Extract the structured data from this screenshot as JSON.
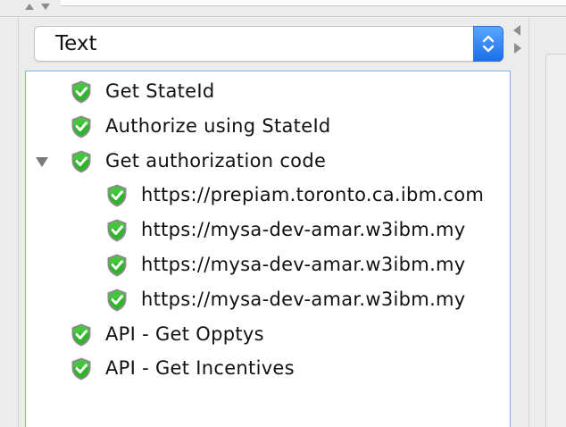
{
  "selector": {
    "value": "Text"
  },
  "tree": {
    "items": [
      {
        "label": "Get StateId",
        "level": 0,
        "status": "success",
        "icon": "green-shield-check-icon"
      },
      {
        "label": "Authorize using StateId",
        "level": 0,
        "status": "success",
        "icon": "green-shield-check-icon"
      },
      {
        "label": "Get authorization code",
        "level": 0,
        "status": "success",
        "icon": "green-shield-check-icon",
        "expanded": true
      },
      {
        "label": "https://prepiam.toronto.ca.ibm.com",
        "level": 1,
        "status": "success",
        "icon": "green-shield-check-icon"
      },
      {
        "label": "https://mysa-dev-amar.w3ibm.my",
        "level": 1,
        "status": "success",
        "icon": "green-shield-check-icon"
      },
      {
        "label": "https://mysa-dev-amar.w3ibm.my",
        "level": 1,
        "status": "success",
        "icon": "green-shield-check-icon"
      },
      {
        "label": "https://mysa-dev-amar.w3ibm.my",
        "level": 1,
        "status": "success",
        "icon": "green-shield-check-icon"
      },
      {
        "label": "API - Get Opptys",
        "level": 0,
        "status": "success",
        "icon": "green-shield-check-icon"
      },
      {
        "label": "API - Get Incentives",
        "level": 0,
        "status": "success",
        "icon": "green-shield-check-icon"
      }
    ]
  },
  "colors": {
    "accent": "#1b6fea",
    "success": "#2fb52a",
    "tree_border": "#84aee0"
  }
}
